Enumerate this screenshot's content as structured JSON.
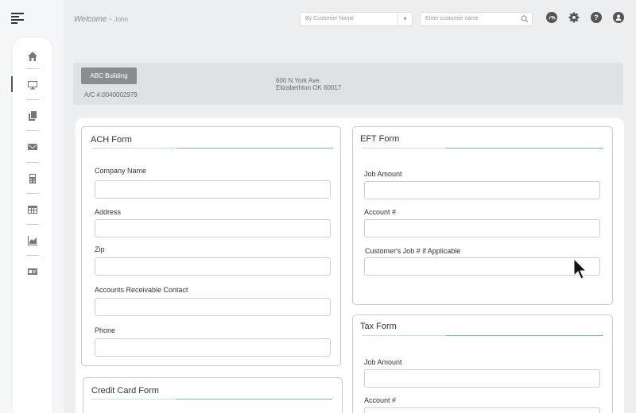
{
  "topbar": {
    "welcome": "Welcome -",
    "user": "John",
    "customer_select_placeholder": "By Customer Name",
    "search_placeholder": "Enter customer name"
  },
  "banner": {
    "building_button": "ABC Building",
    "account": "A/C #:0040002979",
    "address_line1": "600 N York Ave.",
    "address_line2": "Elizabethton OK 60017"
  },
  "ach_form": {
    "title": "ACH Form",
    "fields": [
      "Company Name",
      "Address",
      "Zip",
      "Accounts Receivable Contact",
      "Phone"
    ]
  },
  "eft_form": {
    "title": "EFT Form",
    "fields": [
      "Job Amount",
      "Account #",
      "Customer's Job # if Applicable"
    ]
  },
  "tax_form": {
    "title": "Tax Form",
    "fields": [
      "Job Amount",
      "Account #"
    ]
  },
  "credit_card_form": {
    "title": "Credit Card Form"
  }
}
